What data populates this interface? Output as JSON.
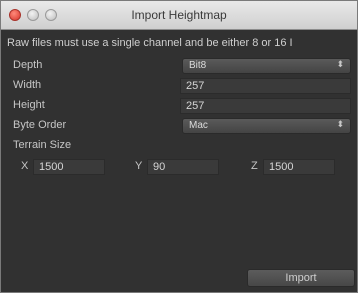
{
  "window": {
    "title": "Import Heightmap"
  },
  "notice": "Raw files must use a single channel and be either 8 or 16 I",
  "fields": {
    "depth": {
      "label": "Depth",
      "value": "Bit8"
    },
    "width": {
      "label": "Width",
      "value": "257"
    },
    "height": {
      "label": "Height",
      "value": "257"
    },
    "byte_order": {
      "label": "Byte Order",
      "value": "Mac"
    }
  },
  "terrain_size": {
    "label": "Terrain Size",
    "x_label": "X",
    "x": "1500",
    "y_label": "Y",
    "y": "90",
    "z_label": "Z",
    "z": "1500"
  },
  "import_label": "Import",
  "icons": {
    "dropdown_arrow": "⬍"
  }
}
